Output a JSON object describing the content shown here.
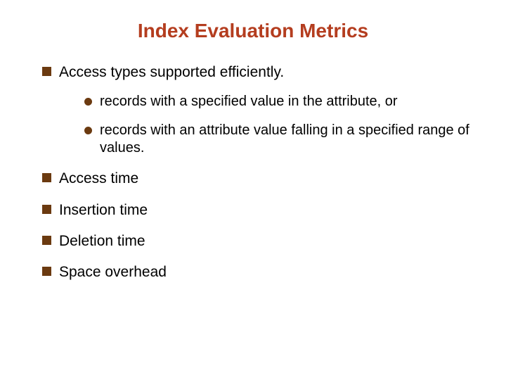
{
  "title": "Index Evaluation Metrics",
  "items": [
    {
      "text": "Access types supported efficiently.",
      "sub": [
        "records with a specified value in the attribute, or",
        "records with an attribute value falling in a specified range of values."
      ]
    },
    {
      "text": "Access time"
    },
    {
      "text": "Insertion time"
    },
    {
      "text": "Deletion time"
    },
    {
      "text": "Space overhead"
    }
  ]
}
